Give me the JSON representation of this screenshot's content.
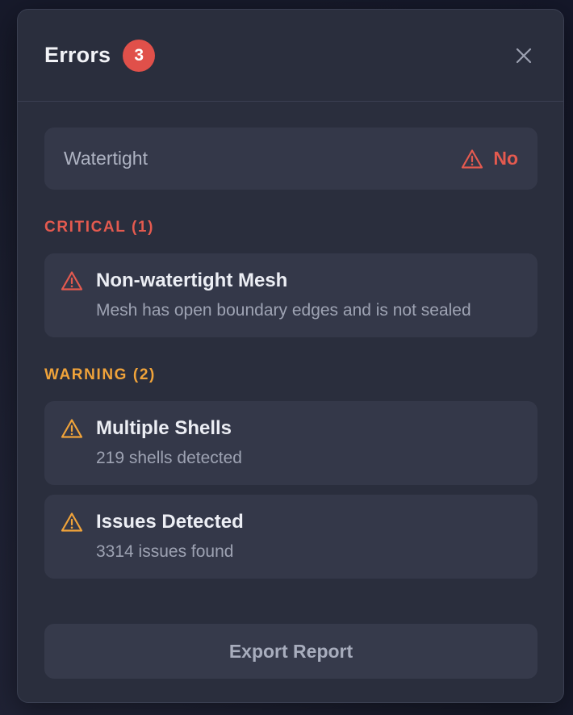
{
  "header": {
    "title": "Errors",
    "badge_count": "3",
    "close_icon": "close-icon"
  },
  "status": {
    "label": "Watertight",
    "value": "No",
    "icon": "warning-triangle-icon",
    "color": "#e45a4f"
  },
  "sections": [
    {
      "title": "CRITICAL (1)",
      "color": "#e45a4f",
      "issues": [
        {
          "title": "Non-watertight Mesh",
          "description": "Mesh has open boundary edges and is not sealed",
          "icon": "warning-triangle-icon"
        }
      ]
    },
    {
      "title": "WARNING (2)",
      "color": "#f0a33a",
      "issues": [
        {
          "title": "Multiple Shells",
          "description": "219 shells detected",
          "icon": "warning-triangle-icon"
        },
        {
          "title": "Issues Detected",
          "description": "3314 issues found",
          "icon": "warning-triangle-icon"
        }
      ]
    }
  ],
  "footer": {
    "export_label": "Export Report"
  }
}
